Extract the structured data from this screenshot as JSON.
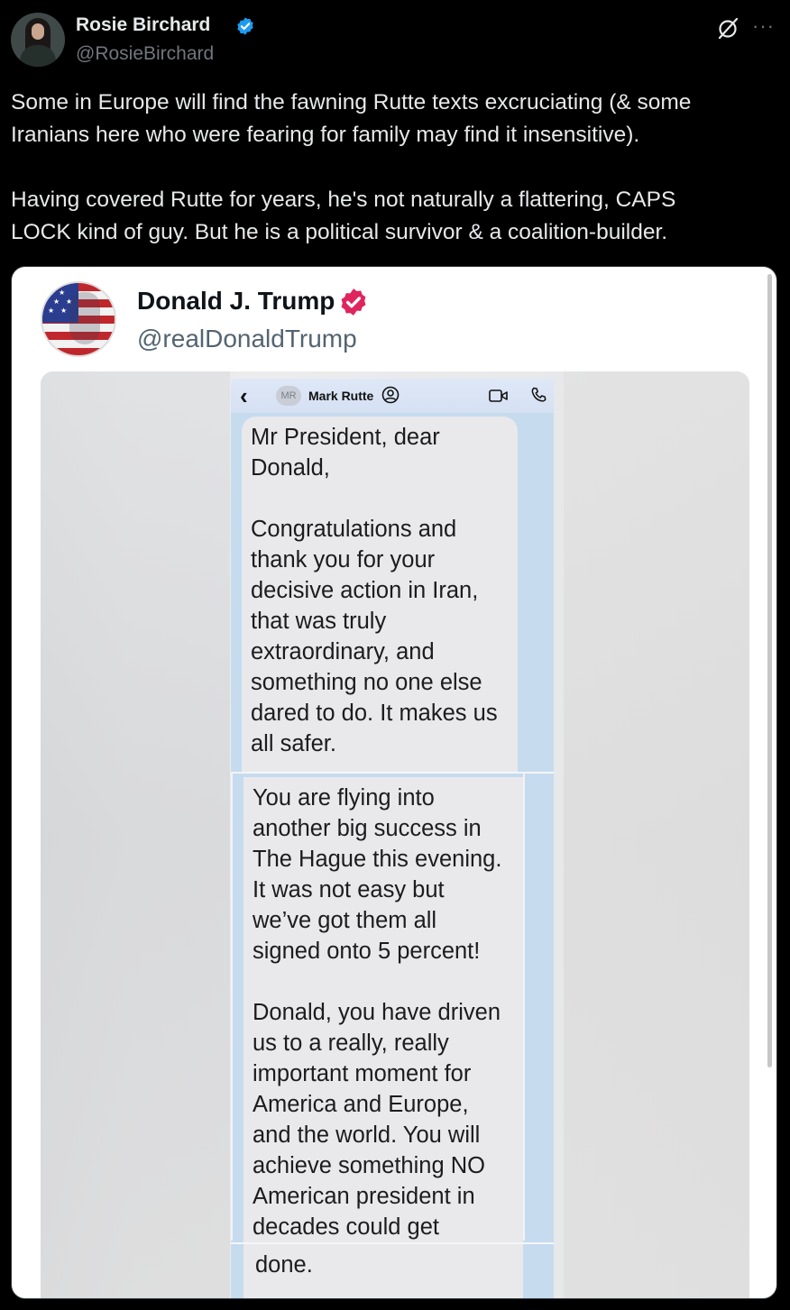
{
  "tweet": {
    "author_name": "Rosie Birchard",
    "author_handle": "@RosieBirchard",
    "more_label": "···",
    "paragraphs": [
      "Some in Europe will find the fawning Rutte texts excruciating (& some\nIranians here who were fearing for family may find it insensitive).",
      "Having covered Rutte for years, he's not naturally a flattering, CAPS\nLOCK kind of guy. But he is a political survivor & a coalition-builder."
    ]
  },
  "embed": {
    "author_name": "Donald J. Trump",
    "author_handle": "@realDonaldTrump",
    "phone": {
      "contact_initials": "MR",
      "contact_name": "Mark Rutte",
      "back_glyph": "‹"
    },
    "messages": [
      "Mr President, dear\nDonald,\n\nCongratulations and\nthank you for your\ndecisive action in Iran,\nthat was truly\nextraordinary, and\nsomething no one else\ndared to do.  It makes us\nall safer.",
      "You are flying into\nanother big success in\nThe Hague this evening.\nIt was not easy but\nwe’ve got them all\nsigned onto 5 percent!\n\nDonald, you have driven\nus to a really, really\nimportant moment for\nAmerica and Europe,\nand the world.  You will\nachieve something NO\nAmerican president in\ndecades could get",
      "done."
    ]
  },
  "colors": {
    "background": "#000000",
    "text_primary": "#e7e9ea",
    "text_secondary": "#71767b",
    "verified_blue": "#1d9bf0",
    "verified_pink": "#e0245e",
    "imessage_grey": "#e9e9eb"
  },
  "icons": {
    "verified": "verified-badge-icon",
    "grok": "grok-icon",
    "more": "more-options-icon",
    "back": "chevron-left-icon",
    "contact": "contact-info-icon",
    "video": "video-call-icon",
    "phone": "phone-call-icon"
  }
}
